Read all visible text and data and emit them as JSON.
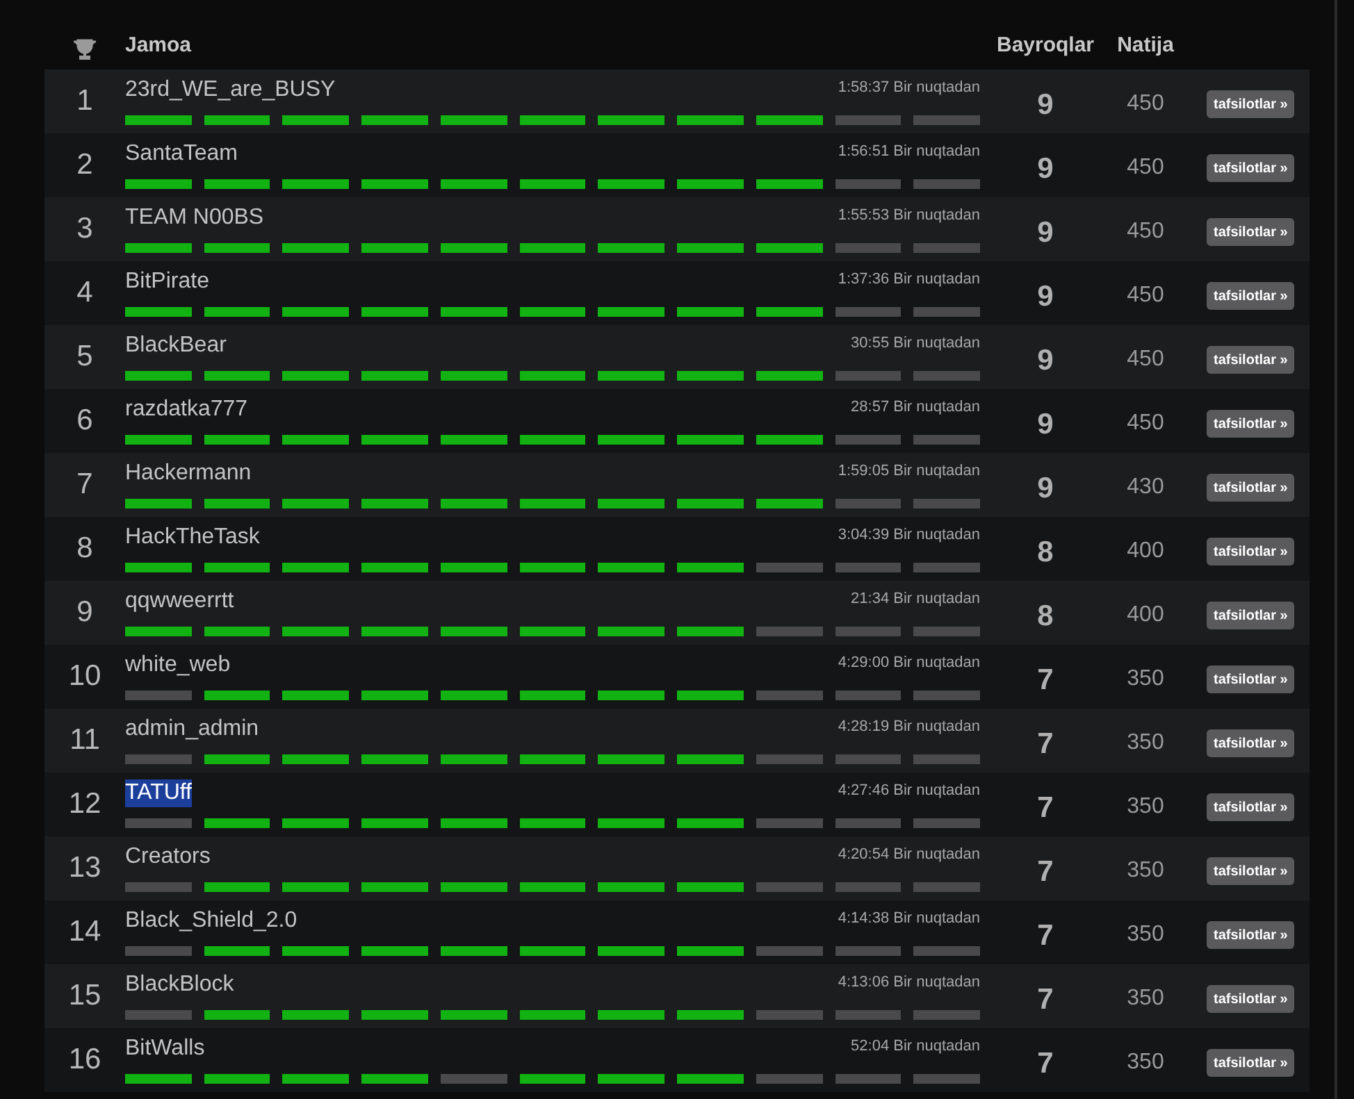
{
  "header": {
    "team": "Jamoa",
    "flags": "Bayroqlar",
    "score": "Natija"
  },
  "rows": [
    {
      "rank": "1",
      "team": "23rd_WE_are_BUSY",
      "time": "1:58:37 Bir nuqtadan",
      "flags": "9",
      "score": "450",
      "button": "tafsilotlar »",
      "selected": false,
      "solved": [
        true,
        true,
        true,
        true,
        true,
        true,
        true,
        true,
        true,
        false,
        false
      ]
    },
    {
      "rank": "2",
      "team": "SantaTeam",
      "time": "1:56:51 Bir nuqtadan",
      "flags": "9",
      "score": "450",
      "button": "tafsilotlar »",
      "selected": false,
      "solved": [
        true,
        true,
        true,
        true,
        true,
        true,
        true,
        true,
        true,
        false,
        false
      ]
    },
    {
      "rank": "3",
      "team": "TEAM N00BS",
      "time": "1:55:53 Bir nuqtadan",
      "flags": "9",
      "score": "450",
      "button": "tafsilotlar »",
      "selected": false,
      "solved": [
        true,
        true,
        true,
        true,
        true,
        true,
        true,
        true,
        true,
        false,
        false
      ]
    },
    {
      "rank": "4",
      "team": "BitPirate",
      "time": "1:37:36 Bir nuqtadan",
      "flags": "9",
      "score": "450",
      "button": "tafsilotlar »",
      "selected": false,
      "solved": [
        true,
        true,
        true,
        true,
        true,
        true,
        true,
        true,
        true,
        false,
        false
      ]
    },
    {
      "rank": "5",
      "team": "BlackBear",
      "time": "30:55 Bir nuqtadan",
      "flags": "9",
      "score": "450",
      "button": "tafsilotlar »",
      "selected": false,
      "solved": [
        true,
        true,
        true,
        true,
        true,
        true,
        true,
        true,
        true,
        false,
        false
      ]
    },
    {
      "rank": "6",
      "team": "razdatka777",
      "time": "28:57 Bir nuqtadan",
      "flags": "9",
      "score": "450",
      "button": "tafsilotlar »",
      "selected": false,
      "solved": [
        true,
        true,
        true,
        true,
        true,
        true,
        true,
        true,
        true,
        false,
        false
      ]
    },
    {
      "rank": "7",
      "team": "Hackermann",
      "time": "1:59:05 Bir nuqtadan",
      "flags": "9",
      "score": "430",
      "button": "tafsilotlar »",
      "selected": false,
      "solved": [
        true,
        true,
        true,
        true,
        true,
        true,
        true,
        true,
        true,
        false,
        false
      ]
    },
    {
      "rank": "8",
      "team": "HackTheTask",
      "time": "3:04:39 Bir nuqtadan",
      "flags": "8",
      "score": "400",
      "button": "tafsilotlar »",
      "selected": false,
      "solved": [
        true,
        true,
        true,
        true,
        true,
        true,
        true,
        true,
        false,
        false,
        false
      ]
    },
    {
      "rank": "9",
      "team": "qqwweerrtt",
      "time": "21:34 Bir nuqtadan",
      "flags": "8",
      "score": "400",
      "button": "tafsilotlar »",
      "selected": false,
      "solved": [
        true,
        true,
        true,
        true,
        true,
        true,
        true,
        true,
        false,
        false,
        false
      ]
    },
    {
      "rank": "10",
      "team": "white_web",
      "time": "4:29:00 Bir nuqtadan",
      "flags": "7",
      "score": "350",
      "button": "tafsilotlar »",
      "selected": false,
      "solved": [
        false,
        true,
        true,
        true,
        true,
        true,
        true,
        true,
        false,
        false,
        false
      ]
    },
    {
      "rank": "11",
      "team": "admin_admin",
      "time": "4:28:19 Bir nuqtadan",
      "flags": "7",
      "score": "350",
      "button": "tafsilotlar »",
      "selected": false,
      "solved": [
        false,
        true,
        true,
        true,
        true,
        true,
        true,
        true,
        false,
        false,
        false
      ]
    },
    {
      "rank": "12",
      "team": "TATUff",
      "time": "4:27:46 Bir nuqtadan",
      "flags": "7",
      "score": "350",
      "button": "tafsilotlar »",
      "selected": true,
      "solved": [
        false,
        true,
        true,
        true,
        true,
        true,
        true,
        true,
        false,
        false,
        false
      ]
    },
    {
      "rank": "13",
      "team": "Creators",
      "time": "4:20:54 Bir nuqtadan",
      "flags": "7",
      "score": "350",
      "button": "tafsilotlar »",
      "selected": false,
      "solved": [
        false,
        true,
        true,
        true,
        true,
        true,
        true,
        true,
        false,
        false,
        false
      ]
    },
    {
      "rank": "14",
      "team": "Black_Shield_2.0",
      "time": "4:14:38 Bir nuqtadan",
      "flags": "7",
      "score": "350",
      "button": "tafsilotlar »",
      "selected": false,
      "solved": [
        false,
        true,
        true,
        true,
        true,
        true,
        true,
        true,
        false,
        false,
        false
      ]
    },
    {
      "rank": "15",
      "team": "BlackBlock",
      "time": "4:13:06 Bir nuqtadan",
      "flags": "7",
      "score": "350",
      "button": "tafsilotlar »",
      "selected": false,
      "solved": [
        false,
        true,
        true,
        true,
        true,
        true,
        true,
        true,
        false,
        false,
        false
      ]
    },
    {
      "rank": "16",
      "team": "BitWalls",
      "time": "52:04 Bir nuqtadan",
      "flags": "7",
      "score": "350",
      "button": "tafsilotlar »",
      "selected": false,
      "solved": [
        true,
        true,
        true,
        true,
        false,
        true,
        true,
        true,
        false,
        false,
        false
      ]
    }
  ]
}
